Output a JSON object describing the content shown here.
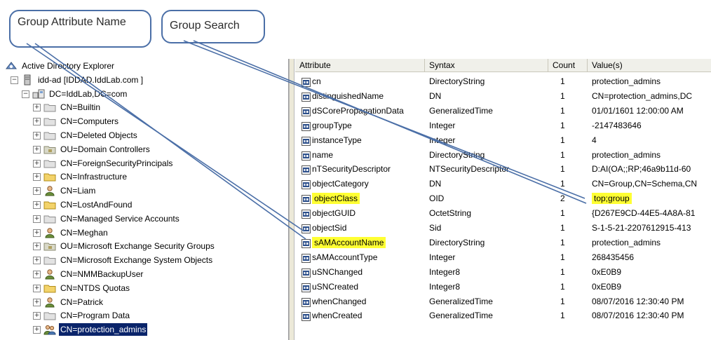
{
  "callouts": {
    "attr_name": "Group Attribute Name",
    "group_search": "Group Search"
  },
  "tree": {
    "items": [
      {
        "label": "Active Directory Explorer",
        "icon": "ad-explorer-icon",
        "expander": ""
      },
      {
        "label": "idd-ad [IDDAD.IddLab.com ]",
        "icon": "server-icon",
        "expander": "−"
      },
      {
        "label": "DC=IddLab,DC=com",
        "icon": "domain-icon",
        "expander": "−"
      },
      {
        "label": "CN=Builtin",
        "icon": "container-icon",
        "expander": "+"
      },
      {
        "label": "CN=Computers",
        "icon": "container-icon",
        "expander": "+"
      },
      {
        "label": "CN=Deleted Objects",
        "icon": "container-icon",
        "expander": "+"
      },
      {
        "label": "OU=Domain Controllers",
        "icon": "ou-icon",
        "expander": "+"
      },
      {
        "label": "CN=ForeignSecurityPrincipals",
        "icon": "container-icon",
        "expander": "+"
      },
      {
        "label": "CN=Infrastructure",
        "icon": "folder-icon",
        "expander": "+"
      },
      {
        "label": "CN=Liam",
        "icon": "user-icon",
        "expander": "+"
      },
      {
        "label": "CN=LostAndFound",
        "icon": "folder-icon",
        "expander": "+"
      },
      {
        "label": "CN=Managed Service Accounts",
        "icon": "container-icon",
        "expander": "+"
      },
      {
        "label": "CN=Meghan",
        "icon": "user-icon",
        "expander": "+"
      },
      {
        "label": "OU=Microsoft Exchange Security Groups",
        "icon": "ou-icon",
        "expander": "+"
      },
      {
        "label": "CN=Microsoft Exchange System Objects",
        "icon": "container-icon",
        "expander": "+"
      },
      {
        "label": "CN=NMMBackupUser",
        "icon": "user-icon",
        "expander": "+"
      },
      {
        "label": "CN=NTDS Quotas",
        "icon": "folder-icon",
        "expander": "+"
      },
      {
        "label": "CN=Patrick",
        "icon": "user-icon",
        "expander": "+"
      },
      {
        "label": "CN=Program Data",
        "icon": "container-icon",
        "expander": "+"
      },
      {
        "label": "CN=protection_admins",
        "icon": "group-icon",
        "expander": "+",
        "selected": true
      }
    ]
  },
  "grid": {
    "columns": [
      "Attribute",
      "Syntax",
      "Count",
      "Value(s)"
    ],
    "rows": [
      {
        "attribute": "cn",
        "syntax": "DirectoryString",
        "count": "1",
        "value": "protection_admins"
      },
      {
        "attribute": "distinguishedName",
        "syntax": "DN",
        "count": "1",
        "value": "CN=protection_admins,DC"
      },
      {
        "attribute": "dSCorePropagationData",
        "syntax": "GeneralizedTime",
        "count": "1",
        "value": "01/01/1601 12:00:00 AM"
      },
      {
        "attribute": "groupType",
        "syntax": "Integer",
        "count": "1",
        "value": "-2147483646"
      },
      {
        "attribute": "instanceType",
        "syntax": "Integer",
        "count": "1",
        "value": "4"
      },
      {
        "attribute": "name",
        "syntax": "DirectoryString",
        "count": "1",
        "value": "protection_admins"
      },
      {
        "attribute": "nTSecurityDescriptor",
        "syntax": "NTSecurityDescriptor",
        "count": "1",
        "value": "D:AI(OA;;RP;46a9b11d-60"
      },
      {
        "attribute": "objectCategory",
        "syntax": "DN",
        "count": "1",
        "value": "CN=Group,CN=Schema,CN"
      },
      {
        "attribute": "objectClass",
        "syntax": "OID",
        "count": "2",
        "value": "top;group",
        "highlight_attr": true,
        "highlight_value": true
      },
      {
        "attribute": "objectGUID",
        "syntax": "OctetString",
        "count": "1",
        "value": "{D267E9CD-44E5-4A8A-81"
      },
      {
        "attribute": "objectSid",
        "syntax": "Sid",
        "count": "1",
        "value": "S-1-5-21-2207612915-413"
      },
      {
        "attribute": "sAMAccountName",
        "syntax": "DirectoryString",
        "count": "1",
        "value": "protection_admins",
        "highlight_attr": true
      },
      {
        "attribute": "sAMAccountType",
        "syntax": "Integer",
        "count": "1",
        "value": "268435456"
      },
      {
        "attribute": "uSNChanged",
        "syntax": "Integer8",
        "count": "1",
        "value": "0xE0B9"
      },
      {
        "attribute": "uSNCreated",
        "syntax": "Integer8",
        "count": "1",
        "value": "0xE0B9"
      },
      {
        "attribute": "whenChanged",
        "syntax": "GeneralizedTime",
        "count": "1",
        "value": "08/07/2016 12:30:40 PM"
      },
      {
        "attribute": "whenCreated",
        "syntax": "GeneralizedTime",
        "count": "1",
        "value": "08/07/2016 12:30:40 PM"
      }
    ]
  },
  "colors": {
    "highlight": "#ffff33",
    "selection": "#0a246a",
    "callout_border": "#4b6fa7"
  }
}
